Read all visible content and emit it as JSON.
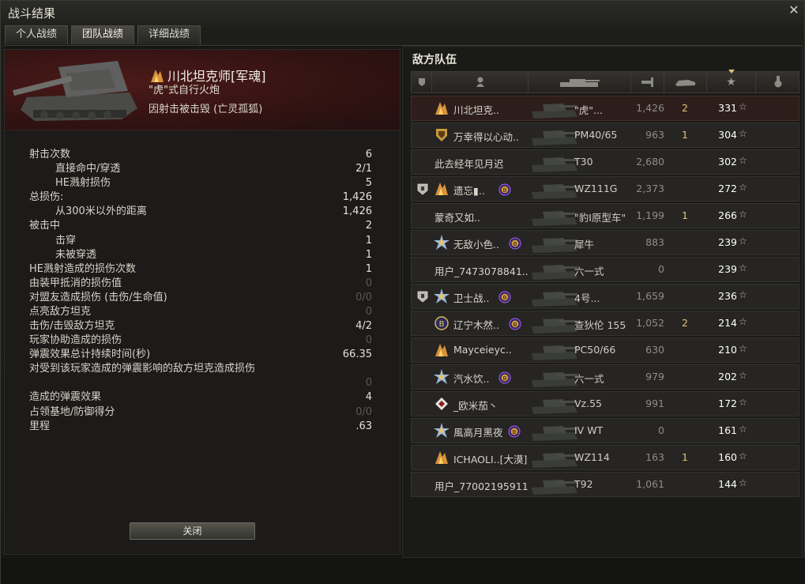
{
  "window": {
    "title": "战斗结果"
  },
  "tabs": [
    {
      "label": "个人战绩"
    },
    {
      "label": "团队战绩"
    },
    {
      "label": "详细战绩"
    }
  ],
  "player": {
    "name": "川北坦克师[军魂]",
    "tank": "\"虎\"式自行火炮",
    "death": "因射击被击毁 (亡灵孤狐)"
  },
  "stats": [
    {
      "label": "射击次数",
      "value": "6",
      "indent": false,
      "dim": false
    },
    {
      "label": "直接命中/穿透",
      "value": "2/1",
      "indent": true,
      "dim": false
    },
    {
      "label": "HE溅射损伤",
      "value": "5",
      "indent": true,
      "dim": false
    },
    {
      "label": "总损伤:",
      "value": "1,426",
      "indent": false,
      "dim": false
    },
    {
      "label": "从300米以外的距离",
      "value": "1,426",
      "indent": true,
      "dim": false
    },
    {
      "label": "被击中",
      "value": "2",
      "indent": false,
      "dim": false
    },
    {
      "label": "击穿",
      "value": "1",
      "indent": true,
      "dim": false
    },
    {
      "label": "未被穿透",
      "value": "1",
      "indent": true,
      "dim": false
    },
    {
      "label": "HE溅射造成的损伤次数",
      "value": "1",
      "indent": false,
      "dim": false
    },
    {
      "label": "由装甲抵消的损伤值",
      "value": "0",
      "indent": false,
      "dim": true
    },
    {
      "label": "对盟友造成损伤 (击伤/生命值)",
      "value": "0/0",
      "indent": false,
      "dim": true
    },
    {
      "label": "点亮敌方坦克",
      "value": "0",
      "indent": false,
      "dim": true
    },
    {
      "label": "击伤/击毁敌方坦克",
      "value": "4/2",
      "indent": false,
      "dim": false
    },
    {
      "label": "玩家协助造成的损伤",
      "value": "0",
      "indent": false,
      "dim": true
    },
    {
      "label": "弹震效果总计持续时间(秒)",
      "value": "66.35",
      "indent": false,
      "dim": false
    },
    {
      "label": "对受到该玩家造成的弹震影响的敌方坦克造成损伤",
      "value": "0",
      "indent": false,
      "dim": true,
      "tall": true
    },
    {
      "label": "造成的弹震效果",
      "value": "4",
      "indent": false,
      "dim": false
    },
    {
      "label": "占领基地/防御得分",
      "value": "0/0",
      "indent": false,
      "dim": true
    },
    {
      "label": "里程",
      "value": ".63",
      "indent": false,
      "dim": false
    }
  ],
  "close_label": "关闭",
  "enemy_team": {
    "title": "敌方队伍",
    "columns": [
      "platoon-icon",
      "player-icon",
      "tank-icon",
      "damage-icon",
      "kills-icon",
      "xp-star-icon",
      "medal-icon"
    ],
    "rows": [
      {
        "name": "川北坦克..",
        "tank": "\"虎\"...",
        "damage": "1,426",
        "kills": "2",
        "xp": "331",
        "badge": "flame",
        "bond": false,
        "platoon": false,
        "self": true
      },
      {
        "name": "万幸得以心动..",
        "tank": "PM40/65",
        "damage": "963",
        "kills": "1",
        "xp": "304",
        "badge": "shield-gold",
        "bond": false,
        "platoon": false,
        "self": false
      },
      {
        "name": "此去经年见月迟",
        "tank": "T30",
        "damage": "2,680",
        "kills": "",
        "xp": "302",
        "badge": "",
        "bond": false,
        "platoon": false,
        "self": false
      },
      {
        "name": "遗忘▮..",
        "tank": "WZ111G",
        "damage": "2,373",
        "kills": "",
        "xp": "272",
        "badge": "flame",
        "bond": true,
        "platoon": true,
        "self": false
      },
      {
        "name": "蒙奇又如..",
        "tank": "\"豹I原型车\"",
        "damage": "1,199",
        "kills": "1",
        "xp": "266",
        "badge": "",
        "bond": false,
        "platoon": false,
        "self": false
      },
      {
        "name": "无敌小色..",
        "tank": "犀牛",
        "damage": "883",
        "kills": "",
        "xp": "239",
        "badge": "star-burst",
        "bond": true,
        "platoon": false,
        "self": false
      },
      {
        "name": "用户_7473078841..",
        "tank": "六一式",
        "damage": "0",
        "kills": "",
        "xp": "239",
        "badge": "",
        "bond": false,
        "platoon": false,
        "self": false
      },
      {
        "name": "卫士战..",
        "tank": "4号...",
        "damage": "1,659",
        "kills": "",
        "xp": "236",
        "badge": "star-burst",
        "bond": true,
        "platoon": true,
        "self": false
      },
      {
        "name": "辽宁木然..",
        "tank": "查狄伦 155",
        "damage": "1,052",
        "kills": "2",
        "xp": "214",
        "badge": "b-coin",
        "bond": true,
        "platoon": false,
        "self": false
      },
      {
        "name": "Mayceieyc..",
        "tank": "PC50/66",
        "damage": "630",
        "kills": "",
        "xp": "210",
        "badge": "flame",
        "bond": false,
        "platoon": false,
        "self": false
      },
      {
        "name": "汽水饮..",
        "tank": "六一式",
        "damage": "979",
        "kills": "",
        "xp": "202",
        "badge": "star-burst",
        "bond": true,
        "platoon": false,
        "self": false
      },
      {
        "name": "_欧米茄丶",
        "tank": "Vz.55",
        "damage": "991",
        "kills": "",
        "xp": "172",
        "badge": "diamond",
        "bond": false,
        "platoon": false,
        "self": false
      },
      {
        "name": "風高月黑夜",
        "tank": "IV WT",
        "damage": "0",
        "kills": "",
        "xp": "161",
        "badge": "star-burst",
        "bond": true,
        "platoon": false,
        "self": false
      },
      {
        "name": "ICHAOLI..[大漠]",
        "tank": "WZ114",
        "damage": "163",
        "kills": "1",
        "xp": "160",
        "badge": "flame",
        "bond": false,
        "platoon": false,
        "self": false
      },
      {
        "name": "用户_77002195911",
        "tank": "T92",
        "damage": "1,061",
        "kills": "",
        "xp": "144",
        "badge": "",
        "bond": false,
        "platoon": false,
        "self": false
      }
    ]
  },
  "colors": {
    "accent": "#e1c078",
    "self_row": "#2d1e1c",
    "banner": "#4b1a19"
  }
}
